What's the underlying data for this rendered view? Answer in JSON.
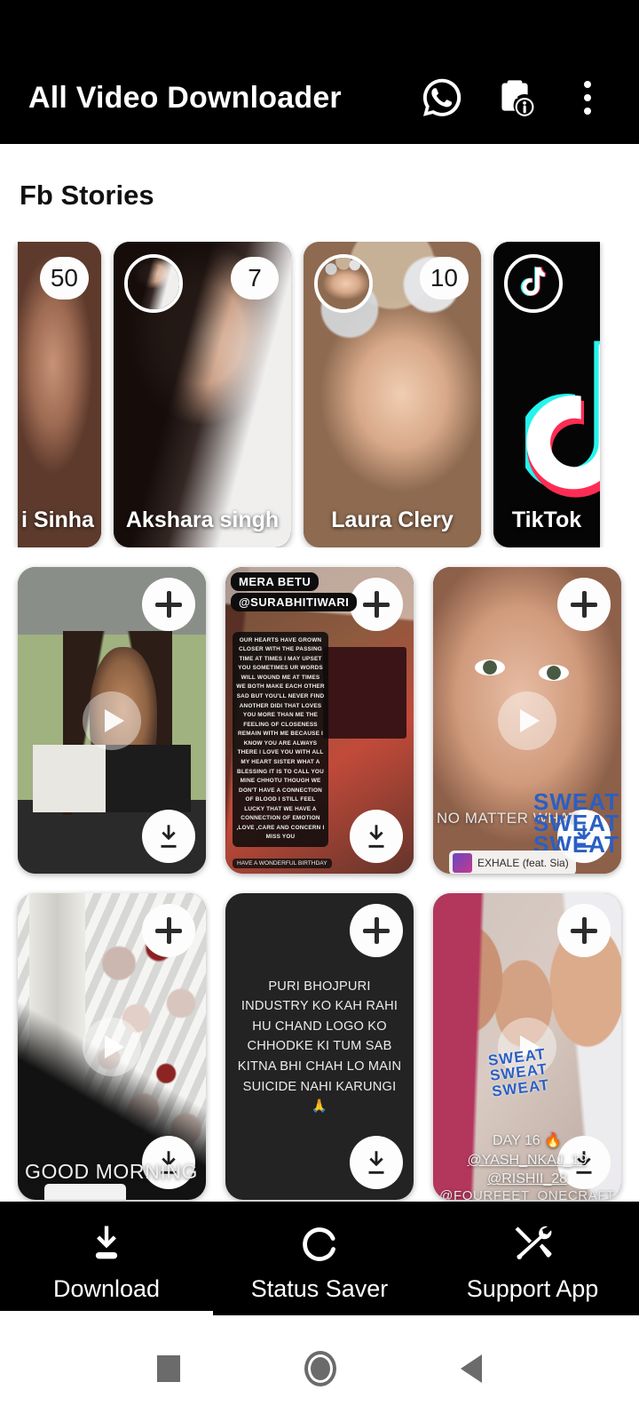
{
  "app": {
    "title": "All Video Downloader",
    "icons": {
      "whatsapp": "whatsapp-icon",
      "clipboard_info": "clipboard-info-icon",
      "overflow": "overflow-menu-icon"
    }
  },
  "section": {
    "title": "Fb Stories"
  },
  "stories": [
    {
      "name": "i Sinha",
      "badge": "50",
      "has_avatar": false,
      "kind": "photo"
    },
    {
      "name": "Akshara singh",
      "badge": "7",
      "has_avatar": true,
      "kind": "photo"
    },
    {
      "name": "Laura Clery",
      "badge": "10",
      "has_avatar": true,
      "kind": "photo"
    },
    {
      "name": "TikTok",
      "badge": "",
      "has_avatar": true,
      "kind": "tiktok"
    }
  ],
  "grid": {
    "add_label": "+",
    "items": [
      {
        "id": "tile-1",
        "caption": "",
        "has_play": true,
        "has_download": true,
        "has_add": true
      },
      {
        "id": "tile-2",
        "tag_line_1": "MERA BETU",
        "tag_line_2": "@SURABHITIWARI",
        "overlay_text": "OUR HEARTS HAVE GROWN CLOSER WITH THE PASSING TIME AT TIMES I MAY UPSET YOU SOMETIMES UR WORDS WILL WOUND ME AT TIMES WE BOTH MAKE EACH OTHER SAD BUT YOU'LL NEVER FIND ANOTHER DIDI THAT LOVES YOU MORE THAN ME THE FEELING OF CLOSENESS REMAIN WITH ME BECAUSE I KNOW YOU ARE ALWAYS THERE I LOVE YOU WITH ALL MY HEART SISTER WHAT A BLESSING IT IS TO CALL YOU MINE CHHOTU THOUGH WE DON'T HAVE A CONNECTION OF BLOOD I STILL FEEL LUCKY THAT WE HAVE A CONNECTION OF EMOTION ,LOVE ,CARE AND CONCERN I MISS YOU",
        "footer_text": "HAVE A WONDERFUL BIRTHDAY",
        "has_play": false,
        "has_download": true,
        "has_add": true
      },
      {
        "id": "tile-3",
        "caption": "NO MATTER WHAT",
        "sweat_text": "SWEAT\nSWEAT\nSWEAT",
        "music": "EXHALE (feat. Sia)",
        "has_play": true,
        "has_download": true,
        "has_add": true
      },
      {
        "id": "tile-4",
        "caption": "GOOD MORNING",
        "has_play": true,
        "has_download": true,
        "has_add": true
      },
      {
        "id": "tile-5",
        "overlay_text": "PURI BHOJPURI INDUSTRY KO KAH RAHI HU CHAND LOGO KO CHHODKE KI TUM SAB KITNA BHI CHAH LO MAIN SUICIDE NAHI KARUNGI 🙏",
        "has_play": false,
        "has_download": true,
        "has_add": true
      },
      {
        "id": "tile-6",
        "sweat_text": "SWEAT\nSWEAT\nSWEAT",
        "line_day": "DAY 16 🔥",
        "line_handle_1": "@YASH_NKAJ_19",
        "line_handle_2": "@RISHII_28",
        "line_credit": "@FOURFEET_ONECRAFT",
        "has_play": true,
        "has_download": true,
        "has_add": true
      }
    ]
  },
  "tabs": [
    {
      "label": "Download",
      "icon": "download-icon",
      "active": true
    },
    {
      "label": "Status Saver",
      "icon": "refresh-icon",
      "active": false
    },
    {
      "label": "Support App",
      "icon": "tools-icon",
      "active": false
    }
  ],
  "system_nav": [
    {
      "name": "recents-button",
      "icon": "square-icon"
    },
    {
      "name": "home-button",
      "icon": "circle-icon"
    },
    {
      "name": "back-button",
      "icon": "triangle-icon"
    }
  ],
  "colors": {
    "appbar_bg": "#000000",
    "page_bg": "#ffffff",
    "accent_blue": "#2a5fc4",
    "tiktok_cyan": "#25f4ee",
    "tiktok_pink": "#fe2c55"
  }
}
